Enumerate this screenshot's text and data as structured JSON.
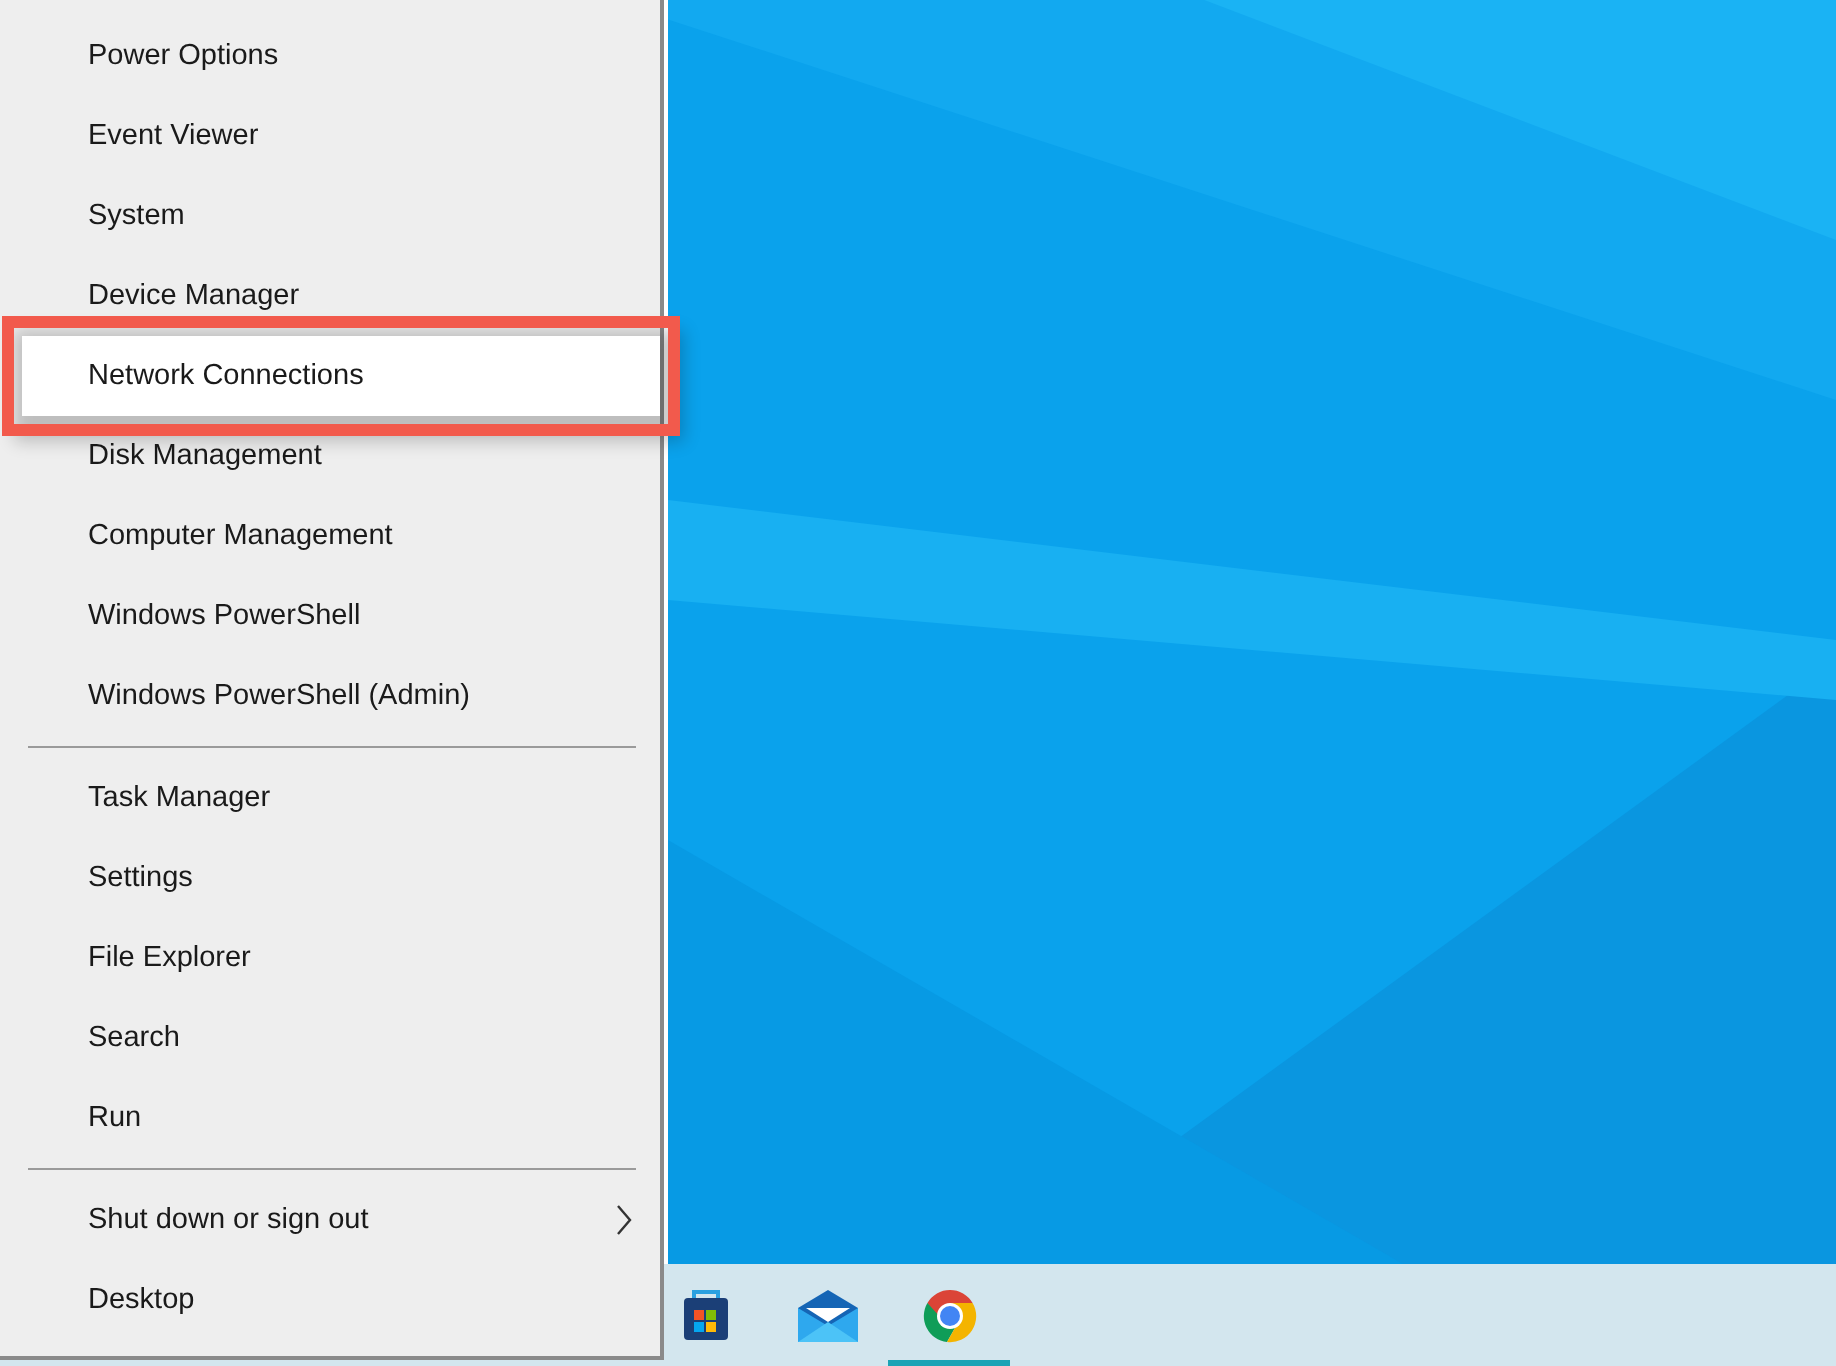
{
  "menu": {
    "groups": [
      {
        "items": [
          {
            "label": "Power Options",
            "highlighted": false,
            "submenu": false
          },
          {
            "label": "Event Viewer",
            "highlighted": false,
            "submenu": false
          },
          {
            "label": "System",
            "highlighted": false,
            "submenu": false
          },
          {
            "label": "Device Manager",
            "highlighted": false,
            "submenu": false
          },
          {
            "label": "Network Connections",
            "highlighted": true,
            "submenu": false
          },
          {
            "label": "Disk Management",
            "highlighted": false,
            "submenu": false
          },
          {
            "label": "Computer Management",
            "highlighted": false,
            "submenu": false
          },
          {
            "label": "Windows PowerShell",
            "highlighted": false,
            "submenu": false
          },
          {
            "label": "Windows PowerShell (Admin)",
            "highlighted": false,
            "submenu": false
          }
        ]
      },
      {
        "items": [
          {
            "label": "Task Manager",
            "highlighted": false,
            "submenu": false
          },
          {
            "label": "Settings",
            "highlighted": false,
            "submenu": false
          },
          {
            "label": "File Explorer",
            "highlighted": false,
            "submenu": false
          },
          {
            "label": "Search",
            "highlighted": false,
            "submenu": false
          },
          {
            "label": "Run",
            "highlighted": false,
            "submenu": false
          }
        ]
      },
      {
        "items": [
          {
            "label": "Shut down or sign out",
            "highlighted": false,
            "submenu": true
          },
          {
            "label": "Desktop",
            "highlighted": false,
            "submenu": false
          }
        ]
      }
    ]
  },
  "taskbar": {
    "apps": [
      {
        "kind": "store",
        "active": false
      },
      {
        "kind": "mail",
        "active": false
      },
      {
        "kind": "browser",
        "active": true
      }
    ]
  }
}
